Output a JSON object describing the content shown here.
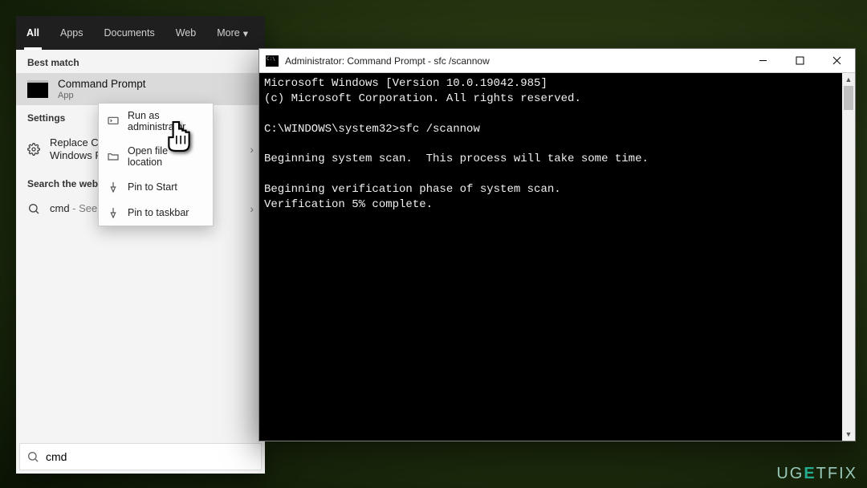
{
  "search": {
    "tabs": {
      "all": "All",
      "apps": "Apps",
      "documents": "Documents",
      "web": "Web",
      "more": "More"
    },
    "best_match_header": "Best match",
    "best_match": {
      "title": "Command Prompt",
      "subtitle": "App"
    },
    "settings_header": "Settings",
    "settings_item": "Replace Command Prompt with Windows PowerShell ...",
    "web_header": "Search the web",
    "web_item_prefix": "cmd",
    "web_item_suffix": " - See web results",
    "input_value": "cmd"
  },
  "context_menu": {
    "run_admin": "Run as administrator",
    "open_location": "Open file location",
    "pin_start": "Pin to Start",
    "pin_taskbar": "Pin to taskbar"
  },
  "terminal": {
    "title": "Administrator: Command Prompt - sfc  /scannow",
    "lines": [
      "Microsoft Windows [Version 10.0.19042.985]",
      "(c) Microsoft Corporation. All rights reserved.",
      "",
      "C:\\WINDOWS\\system32>sfc /scannow",
      "",
      "Beginning system scan.  This process will take some time.",
      "",
      "Beginning verification phase of system scan.",
      "Verification 5% complete."
    ]
  },
  "watermark": "UGETFIX"
}
